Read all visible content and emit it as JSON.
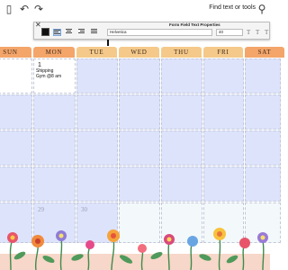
{
  "toolbar": {
    "doc_icon": "document-icon",
    "undo_icon": "undo-icon",
    "redo_icon": "redo-icon",
    "find_label": "Find text or tools",
    "search_icon": "search-icon"
  },
  "dialog": {
    "title": "Form Field Text Properties",
    "close_icon": "close-icon",
    "text_color": "#111111",
    "font": "Helvetica",
    "size": "40"
  },
  "calendar": {
    "days": [
      {
        "label": "SUN",
        "color": "#f4a56a"
      },
      {
        "label": "MON",
        "color": "#f4a56a"
      },
      {
        "label": "TUE",
        "color": "#f5c98a"
      },
      {
        "label": "WED",
        "color": "#f5c98a"
      },
      {
        "label": "THU",
        "color": "#f5c98a"
      },
      {
        "label": "FRI",
        "color": "#f5c98a"
      },
      {
        "label": "SAT",
        "color": "#f4a56a"
      }
    ],
    "mon_date": "1",
    "events": [
      "Shipping",
      "Gym @8 am"
    ],
    "bottom_dates": [
      "29",
      "30"
    ]
  },
  "colors": {
    "field_fill": "#dde3fb",
    "grid_border": "#c3c8d8",
    "accent_orange": "#f4a56a"
  }
}
